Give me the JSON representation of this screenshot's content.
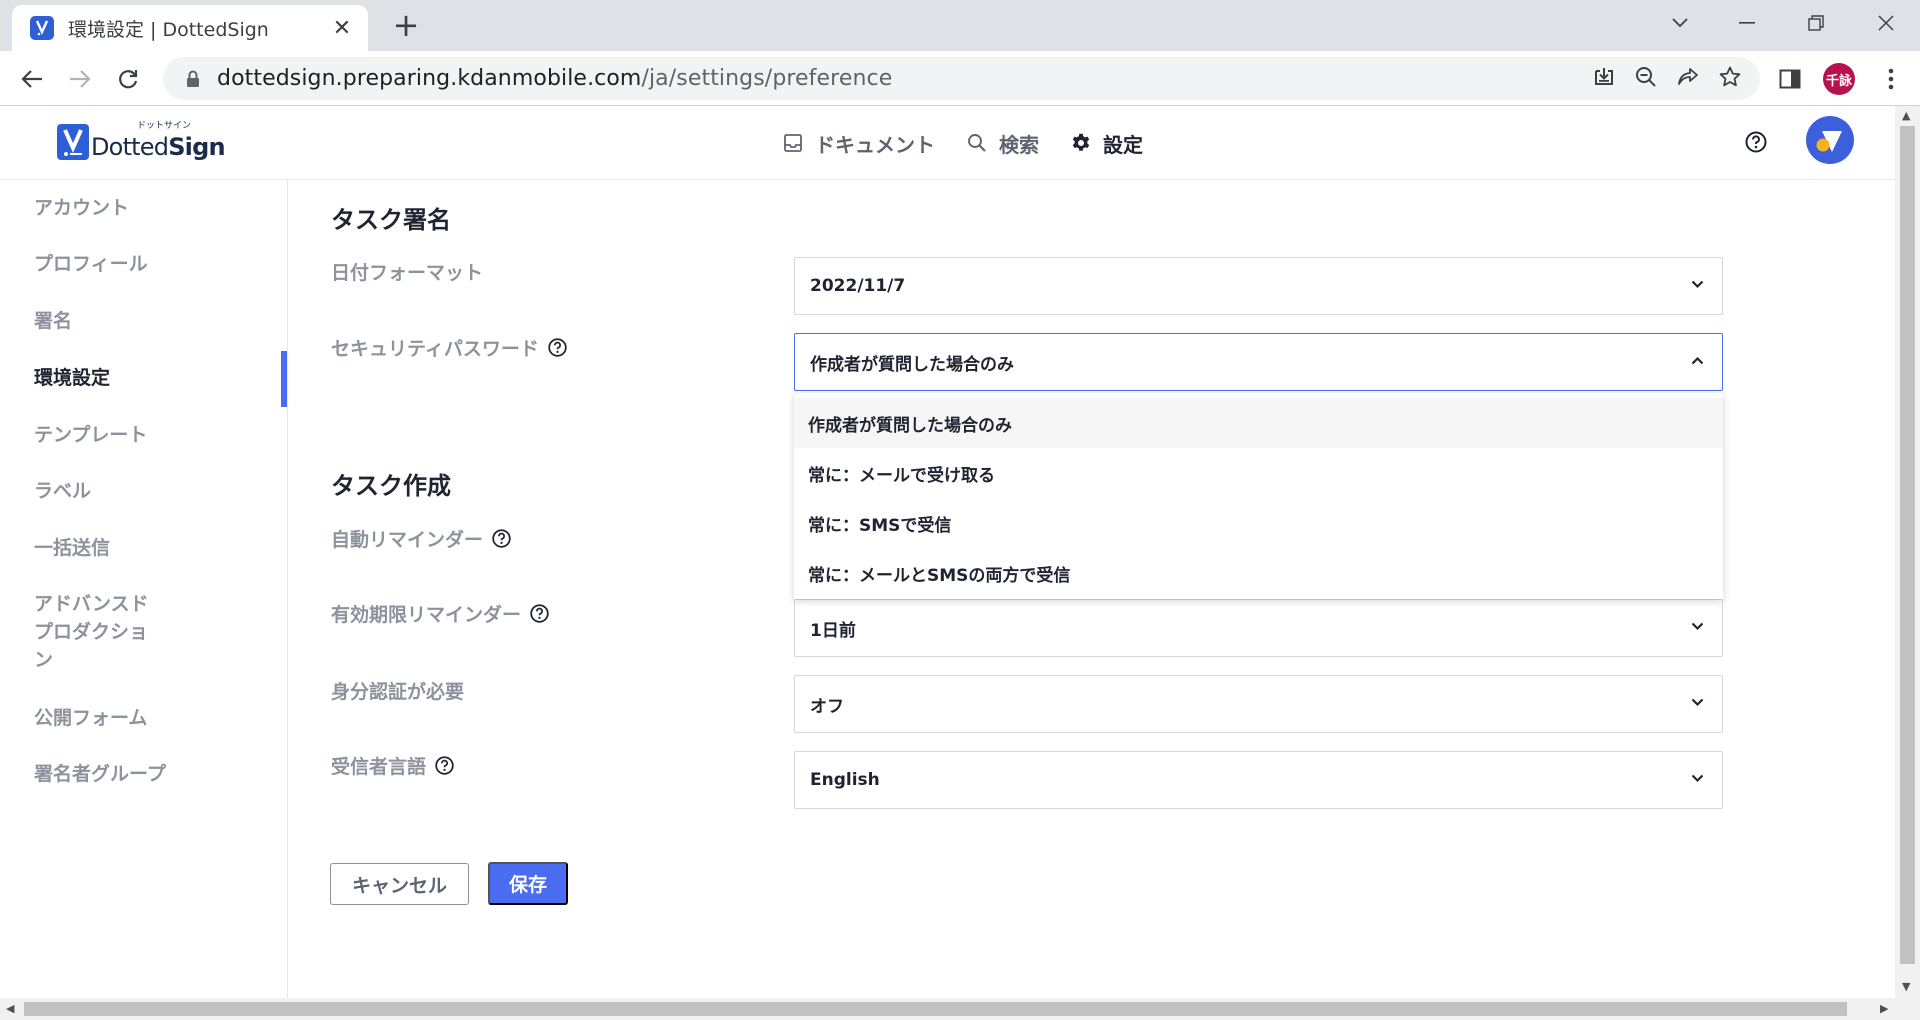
{
  "browser": {
    "tab_title": "環境設定 | DottedSign",
    "url_host": "dottedsign.preparing.kdanmobile.com",
    "url_path": "/ja/settings/preference",
    "profile_initials": "千詠"
  },
  "header": {
    "logo_kana": "ドットサイン",
    "logo_text_light": "Dotted",
    "logo_text_bold": "Sign",
    "nav": [
      {
        "label": "ドキュメント",
        "icon": "inbox-icon"
      },
      {
        "label": "検索",
        "icon": "search-icon"
      },
      {
        "label": "設定",
        "icon": "gear-icon"
      }
    ]
  },
  "sidebar": {
    "items": [
      {
        "label": "アカウント"
      },
      {
        "label": "プロフィール"
      },
      {
        "label": "署名"
      },
      {
        "label": "環境設定"
      },
      {
        "label": "テンプレート"
      },
      {
        "label": "ラベル"
      },
      {
        "label": "一括送信"
      },
      {
        "label": "アドバンスド"
      },
      {
        "label": "プロダクショ"
      },
      {
        "label": "ン"
      },
      {
        "label": "公開フォーム"
      },
      {
        "label": "署名者グループ"
      }
    ]
  },
  "main": {
    "section_signing": "タスク署名",
    "date_format_label": "日付フォーマット",
    "date_format_value": "2022/11/7",
    "security_label": "セキュリティパスワード",
    "security_value": "作成者が質問した場合のみ",
    "security_options": [
      "作成者が質問した場合のみ",
      "常に：メールで受け取る",
      "常に：SMSで受信",
      "常に：メールとSMSの両方で受信"
    ],
    "section_create": "タスク作成",
    "auto_reminder_label": "自動リマインダー",
    "expiry_reminder_label": "有効期限リマインダー",
    "expiry_reminder_value": "1日前",
    "id_required_label": "身分認証が必要",
    "id_required_value": "オフ",
    "recipient_lang_label": "受信者言語",
    "recipient_lang_value": "English",
    "cancel_label": "キャンセル",
    "save_label": "保存"
  },
  "colors": {
    "accent": "#4a6cf0",
    "profile": "#b8124d"
  }
}
